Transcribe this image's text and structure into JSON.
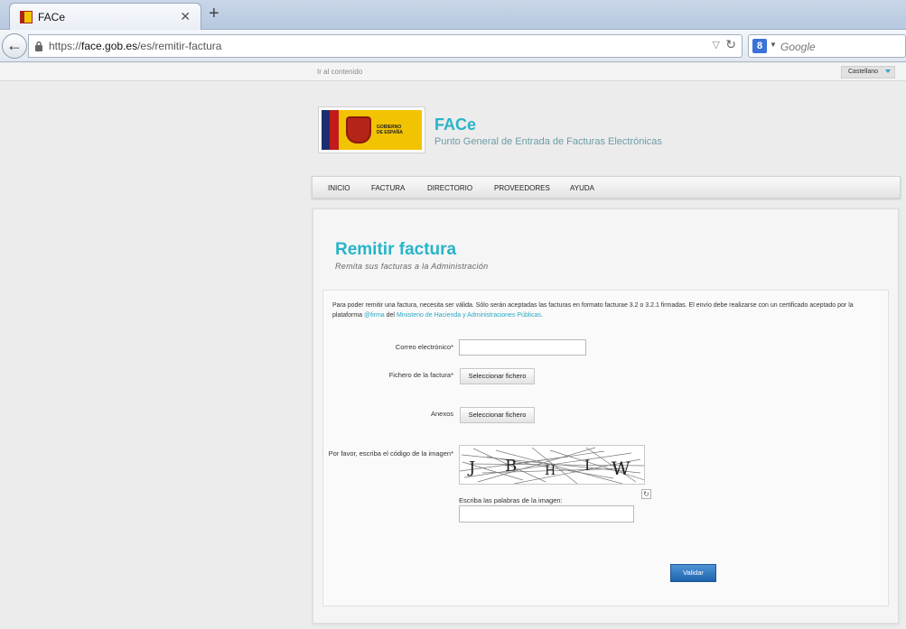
{
  "browser": {
    "tab_title": "FACe",
    "url_prefix": "https://",
    "url_host": "face.gob.es",
    "url_path": "/es/remitir-factura",
    "search_placeholder": "Google",
    "search_engine_icon": "8"
  },
  "site": {
    "skip_link": "Ir al contenido",
    "language": "Castellano",
    "logo_text_line1": "GOBIERNO",
    "logo_text_line2": "DE ESPAÑA",
    "title": "FACe",
    "subtitle": "Punto General de Entrada de Facturas Electrónicas"
  },
  "menu": {
    "items": [
      "INICIO",
      "FACTURA",
      "DIRECTORIO",
      "PROVEEDORES",
      "AYUDA"
    ]
  },
  "page": {
    "title": "Remitir factura",
    "subtitle": "Remita sus facturas a la Administración"
  },
  "intro": {
    "text_1": "Para poder remitir una factura, necesita ser válida. Sólo serán aceptadas las facturas en formato facturae 3.2 o 3.2.1 firmadas. El envío debe realizarse con un certificado aceptado por la plataforma ",
    "link_firma": "@firma",
    "text_2": " del ",
    "link_ministerio": "Ministerio de Hacienda y Administraciones Públicas",
    "text_3": "."
  },
  "form": {
    "email_label": "Correo electrónico*",
    "email_value": "",
    "invoice_file_label": "Fichero de la factura*",
    "invoice_file_button": "Seleccionar fichero",
    "attachments_label": "Anexos",
    "attachments_button": "Seleccionar fichero",
    "captcha_label": "Por favor, escriba el código de la imagen*",
    "captcha_letters": [
      "J",
      "B",
      "H",
      "I",
      "W"
    ],
    "captcha_input_label": "Escriba las palabras de la imagen:",
    "captcha_value": "",
    "submit_button": "Validar"
  },
  "icons": {
    "back": "back-arrow-icon",
    "lock": "lock-icon",
    "reload": "reload-icon",
    "close_tab": "close-icon",
    "new_tab": "plus-icon",
    "refresh_captcha": "refresh-icon"
  },
  "colors": {
    "accent": "#27b4c8",
    "submit": "#2f77c2"
  }
}
